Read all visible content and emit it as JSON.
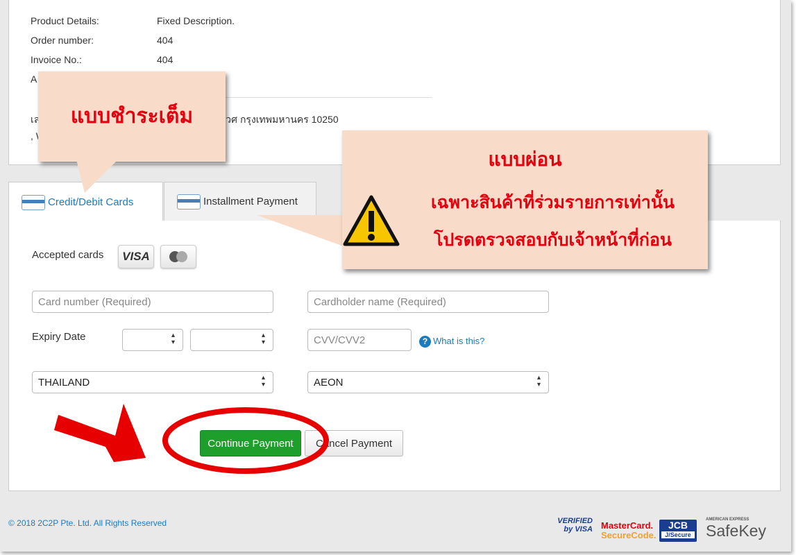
{
  "details": {
    "rows": [
      {
        "label": "Product Details:",
        "value": "Fixed Description."
      },
      {
        "label": "Order number:",
        "value": "404"
      },
      {
        "label": "Invoice No.:",
        "value": "404"
      },
      {
        "label": "A",
        "value": ""
      }
    ],
    "address_line1_start": "เล",
    "address_line1_end": "ะเวศ กรุงเทพมหานคร 10250",
    "address_line2": ", W"
  },
  "tabs": [
    {
      "label": "Credit/Debit Cards",
      "active": true
    },
    {
      "label": "Installment Payment",
      "active": false
    }
  ],
  "form": {
    "accepted_cards_label": "Accepted cards",
    "visa": "VISA",
    "card_number_placeholder": "Card number (Required)",
    "cardholder_placeholder": "Cardholder name (Required)",
    "expiry_label": "Expiry Date",
    "expiry_month": "",
    "expiry_year": "",
    "cvv_placeholder": "CVV/CVV2",
    "what_is_this": "What is this?",
    "country": "THAILAND",
    "bank": "AEON",
    "continue": "Continue Payment",
    "cancel": "Cancel Payment"
  },
  "footer": {
    "copyright": "© 2018 2C2P Pte. Ltd. All Rights Reserved",
    "logos": {
      "verified_visa": "VERIFIED by VISA",
      "mastercard": "MasterCard.",
      "securecode": "SecureCode.",
      "jcb": "JCB",
      "jsecure": "J/Secure",
      "amex": "AMERICAN EXPRESS",
      "safekey": "SafeKey"
    }
  },
  "annotations": {
    "full_payment": "แบบชำระเต็ม",
    "installment_title": "แบบผ่อน",
    "installment_line1": "เฉพาะสินค้าที่ร่วมรายการเท่านั้น",
    "installment_line2": "โปรดตรวจสอบกับเจ้าหน้าที่ก่อน"
  },
  "colors": {
    "accent": "#1a7bbf",
    "continue_button": "#1e9e2a",
    "annotation_red": "#e3000f",
    "callout_bg": "#f8dcc9"
  }
}
